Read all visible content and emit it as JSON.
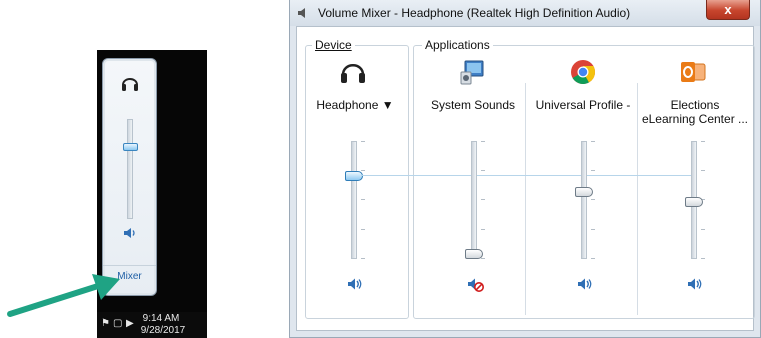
{
  "flyout": {
    "device_icon": "headphone-icon",
    "volume_level": 0.7,
    "speaker_icon": "speaker-icon",
    "mixer_label": "Mixer"
  },
  "taskbar": {
    "time": "9:14 AM",
    "date": "9/28/2017"
  },
  "window": {
    "title": "Volume Mixer - Headphone (Realtek High Definition Audio)",
    "close_label": "x"
  },
  "device": {
    "group_label": "Device",
    "name": "Headphone",
    "icon": "headphone-icon",
    "volume_level": 0.7,
    "muted": false
  },
  "applications": {
    "group_label": "Applications",
    "items": [
      {
        "name": "System Sounds",
        "icon": "system-sounds-icon",
        "volume_level": 0.05,
        "muted": true
      },
      {
        "name": "Universal Profile -",
        "icon": "chrome-icon",
        "volume_level": 0.5,
        "muted": false
      },
      {
        "name": "Elections",
        "name_line2": "eLearning Center ...",
        "icon": "outlook-icon",
        "volume_level": 0.42,
        "muted": false
      }
    ]
  },
  "colors": {
    "accent": "#2f7db8",
    "arrow": "#1fa384",
    "close": "#c7452d"
  }
}
